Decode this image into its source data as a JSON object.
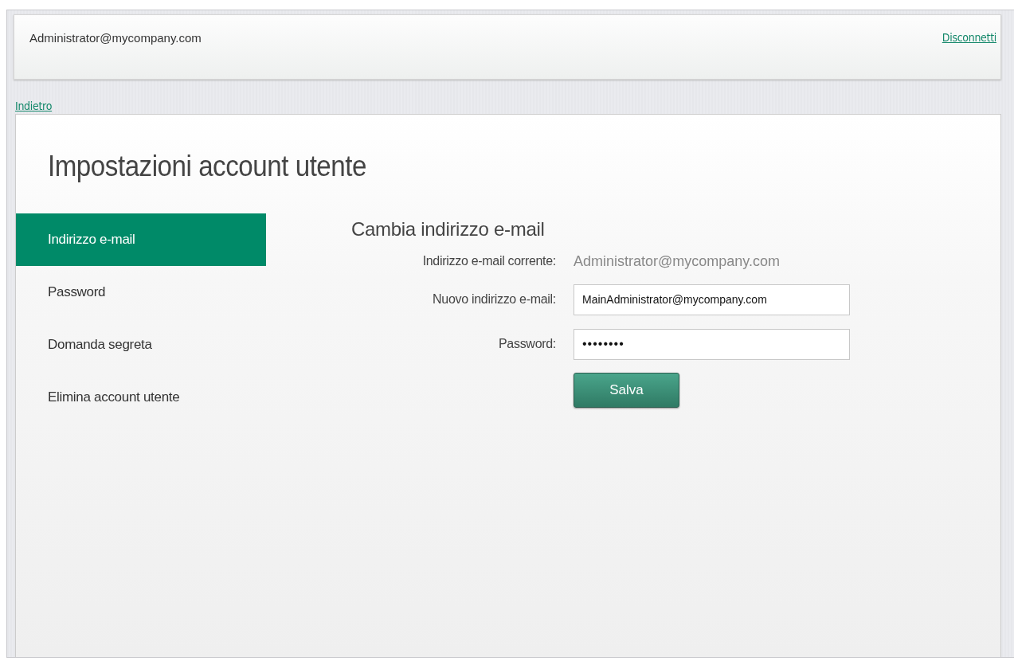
{
  "header": {
    "user": "Administrator@mycompany.com",
    "logout_link": "Disconnetti"
  },
  "back_link": "Indietro",
  "page_title": "Impostazioni account utente",
  "sidebar": {
    "items": [
      {
        "label": "Indirizzo e-mail",
        "selected": true
      },
      {
        "label": "Password",
        "selected": false
      },
      {
        "label": "Domanda segreta",
        "selected": false
      },
      {
        "label": "Elimina account utente",
        "selected": false
      }
    ]
  },
  "form": {
    "title": "Cambia indirizzo e-mail",
    "fields": [
      {
        "kind": "static",
        "label": "Indirizzo e-mail corrente:",
        "value": "Administrator@mycompany.com"
      },
      {
        "kind": "input",
        "label": "Nuovo indirizzo e-mail:",
        "value": "MainAdministrator@mycompany.com"
      },
      {
        "kind": "password",
        "label": "Password:",
        "value": "••••••••"
      }
    ],
    "save_button": "Salva"
  }
}
